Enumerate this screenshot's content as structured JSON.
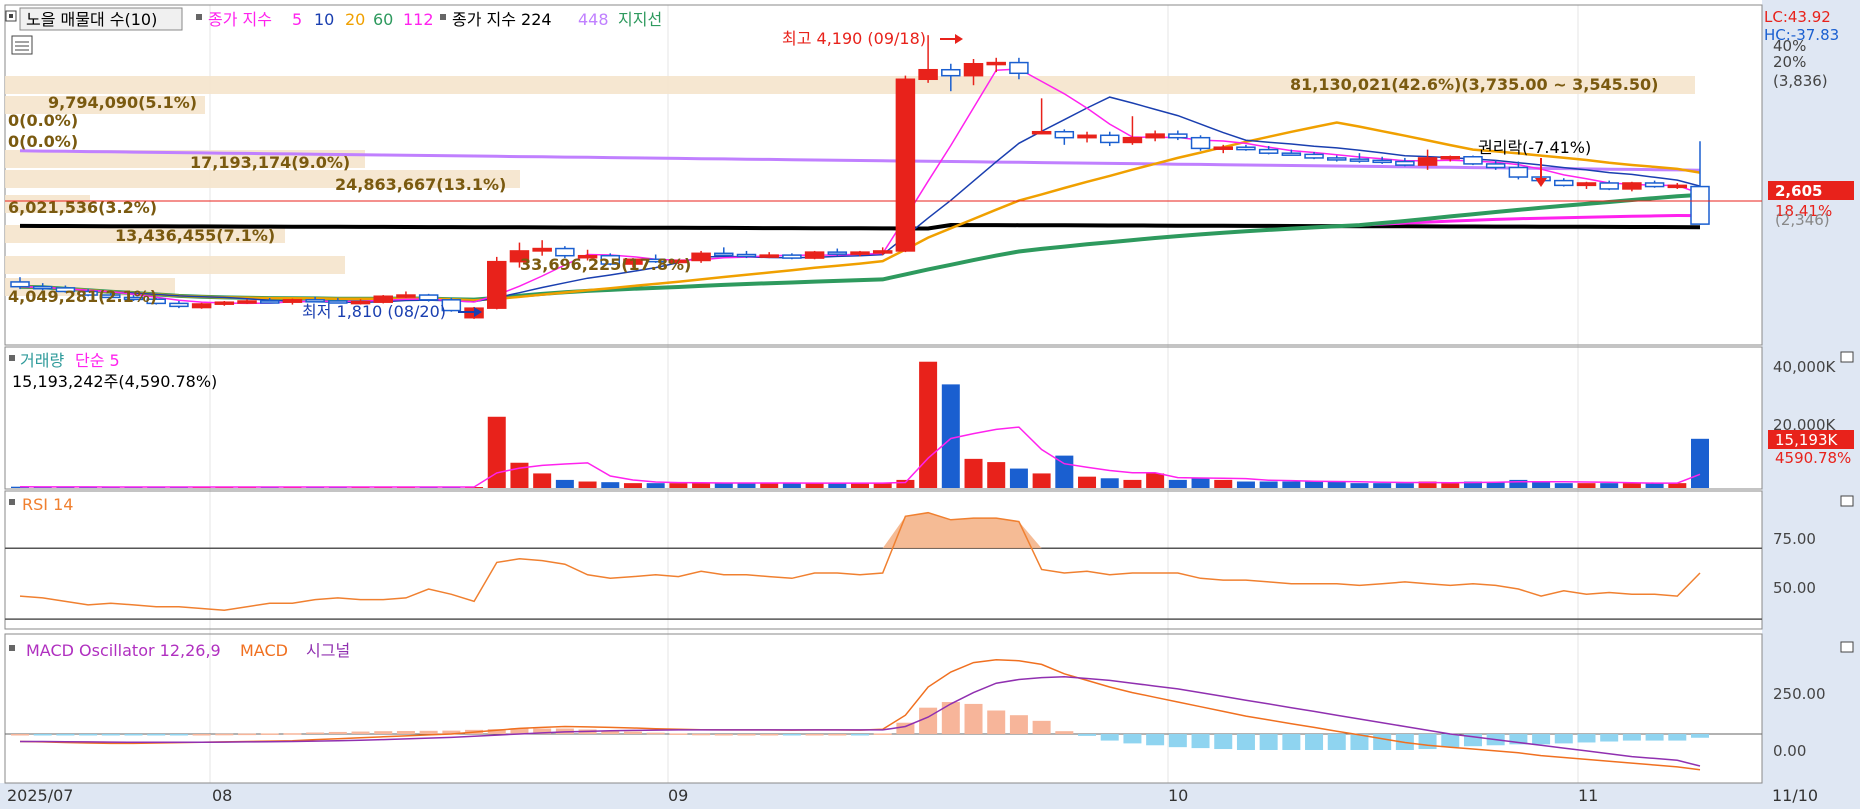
{
  "price_panel": {
    "legend": {
      "volume_profile": "노을 매물대 수(10)",
      "ma_label": "종가 지수",
      "ma_periods": [
        "5",
        "10",
        "20",
        "60",
        "112"
      ],
      "ma2_label": "종가 지수 224",
      "ma2_period": "448",
      "support": "지지선"
    },
    "right_scale": {
      "lc": "LC:43.92",
      "hc": "HC:-37.83",
      "ticks": [
        "40%",
        "20%",
        "(3,836)",
        "18.41%",
        "(2,346)"
      ],
      "current_price": "2,605"
    },
    "annotations": {
      "high": "최고 4,190 (09/18)",
      "low": "최저 1,810 (08/20)",
      "ex_rights": "권리락(-7.41%)"
    },
    "volume_profile_labels": [
      "81,130,021(42.6%)(3,735.00 ~ 3,545.50)",
      "9,794,090(5.1%)",
      "0(0.0%)",
      "0(0.0%)",
      "17,193,174(9.0%)",
      "24,863,667(13.1%)",
      "6,021,536(3.2%)",
      "13,436,455(7.1%)",
      "33,696,225(17.8%)",
      "4,049,281(2.1%)"
    ]
  },
  "volume_panel": {
    "legend_volume": "거래량",
    "legend_ma": "단순 5",
    "info": "15,193,242주(4,590.78%)",
    "ticks": [
      "40,000K",
      "20,000K"
    ],
    "current": "15,193K",
    "current_pct": "4590.78%"
  },
  "rsi_panel": {
    "legend": "RSI 14",
    "ticks": [
      "75.00",
      "50.00"
    ]
  },
  "macd_panel": {
    "legend_osc": "MACD Oscillator 12,26,9",
    "legend_macd": "MACD",
    "legend_signal": "시그널",
    "ticks": [
      "250.00",
      "0.00"
    ]
  },
  "x_axis": {
    "labels": [
      "2025/07",
      "08",
      "09",
      "10",
      "11"
    ],
    "right_label": "11/10"
  },
  "colors": {
    "up": "#e8221b",
    "down": "#1a5fd0",
    "ma5": "#2255d0",
    "ma10": "#1a3fb0",
    "ma20": "#f0a000",
    "ma60": "#2e9a5e",
    "ma112": "#ff22ee",
    "ma224": "#000000",
    "ma448": "#c080ff",
    "profile": "#f5e4cc",
    "rsi": "#f08030",
    "macd": "#f07020",
    "signal": "#9030b0",
    "osc_pos": "#f7b59a",
    "osc_neg": "#8fd4f0"
  },
  "chart_data": [
    {
      "type": "candlestick",
      "title": "",
      "candles": [
        [
          2120,
          2160,
          2060,
          2080
        ],
        [
          2080,
          2110,
          2050,
          2070
        ],
        [
          2070,
          2090,
          2030,
          2040
        ],
        [
          2040,
          2060,
          2000,
          2010
        ],
        [
          2010,
          2030,
          1980,
          1990
        ],
        [
          1990,
          2010,
          1960,
          1975
        ],
        [
          1975,
          1985,
          1930,
          1940
        ],
        [
          1940,
          1960,
          1900,
          1915
        ],
        [
          1905,
          1945,
          1895,
          1935
        ],
        [
          1935,
          1960,
          1920,
          1950
        ],
        [
          1950,
          1975,
          1935,
          1960
        ],
        [
          1960,
          1985,
          1945,
          1950
        ],
        [
          1950,
          1980,
          1930,
          1970
        ],
        [
          1970,
          1995,
          1950,
          1960
        ],
        [
          1960,
          1985,
          1940,
          1950
        ],
        [
          1950,
          1975,
          1930,
          1955
        ],
        [
          1950,
          2010,
          1940,
          2000
        ],
        [
          2000,
          2040,
          1985,
          2010
        ],
        [
          2010,
          2020,
          1955,
          1970
        ],
        [
          1970,
          1985,
          1870,
          1880
        ],
        [
          1820,
          1910,
          1810,
          1900
        ],
        [
          1900,
          2330,
          1890,
          2290
        ],
        [
          2290,
          2450,
          2240,
          2380
        ],
        [
          2380,
          2470,
          2340,
          2400
        ],
        [
          2400,
          2420,
          2320,
          2340
        ],
        [
          2340,
          2390,
          2300,
          2340
        ],
        [
          2340,
          2360,
          2260,
          2270
        ],
        [
          2270,
          2320,
          2240,
          2310
        ],
        [
          2310,
          2350,
          2280,
          2290
        ],
        [
          2290,
          2310,
          2270,
          2300
        ],
        [
          2300,
          2380,
          2280,
          2360
        ],
        [
          2360,
          2410,
          2340,
          2350
        ],
        [
          2350,
          2380,
          2320,
          2340
        ],
        [
          2340,
          2370,
          2320,
          2345
        ],
        [
          2345,
          2360,
          2310,
          2320
        ],
        [
          2320,
          2380,
          2310,
          2370
        ],
        [
          2370,
          2400,
          2340,
          2355
        ],
        [
          2355,
          2380,
          2335,
          2370
        ],
        [
          2370,
          2410,
          2345,
          2380
        ],
        [
          2380,
          3850,
          2370,
          3820
        ],
        [
          3820,
          4190,
          3790,
          3900
        ],
        [
          3900,
          3950,
          3720,
          3850
        ],
        [
          3850,
          3990,
          3770,
          3950
        ],
        [
          3950,
          4000,
          3880,
          3960
        ],
        [
          3960,
          4000,
          3820,
          3870
        ],
        [
          3380,
          3660,
          3360,
          3380
        ],
        [
          3380,
          3400,
          3270,
          3330
        ],
        [
          3330,
          3380,
          3290,
          3350
        ],
        [
          3350,
          3380,
          3260,
          3290
        ],
        [
          3290,
          3510,
          3270,
          3330
        ],
        [
          3330,
          3390,
          3300,
          3360
        ],
        [
          3360,
          3390,
          3310,
          3330
        ],
        [
          3330,
          3350,
          3220,
          3240
        ],
        [
          3240,
          3270,
          3200,
          3250
        ],
        [
          3250,
          3270,
          3220,
          3230
        ],
        [
          3230,
          3260,
          3190,
          3200
        ],
        [
          3200,
          3230,
          3180,
          3190
        ],
        [
          3190,
          3210,
          3150,
          3160
        ],
        [
          3160,
          3180,
          3130,
          3150
        ],
        [
          3150,
          3200,
          3120,
          3140
        ],
        [
          3140,
          3170,
          3110,
          3130
        ],
        [
          3130,
          3160,
          3090,
          3100
        ],
        [
          3100,
          3230,
          3060,
          3160
        ],
        [
          3160,
          3180,
          3130,
          3170
        ],
        [
          3170,
          3180,
          3100,
          3110
        ],
        [
          3110,
          3140,
          3060,
          3080
        ],
        [
          3080,
          3130,
          2980,
          3000
        ],
        [
          3000,
          3020,
          2960,
          2970
        ],
        [
          2970,
          2990,
          2920,
          2930
        ],
        [
          2930,
          2960,
          2900,
          2950
        ],
        [
          2950,
          2970,
          2890,
          2900
        ],
        [
          2900,
          2960,
          2880,
          2950
        ],
        [
          2950,
          2970,
          2910,
          2920
        ],
        [
          2920,
          2950,
          2900,
          2930
        ],
        [
          2920,
          3300,
          2600,
          2605
        ]
      ]
    },
    {
      "type": "bar",
      "title": "거래량",
      "unit": "K",
      "values": [
        400,
        300,
        300,
        300,
        300,
        300,
        300,
        300,
        300,
        300,
        300,
        300,
        300,
        300,
        300,
        300,
        300,
        400,
        300,
        300,
        300,
        22000,
        7800,
        4500,
        2500,
        2000,
        1800,
        1500,
        1500,
        1500,
        1700,
        1500,
        1500,
        1500,
        1500,
        1500,
        1500,
        1500,
        1500,
        2500,
        39000,
        32000,
        9000,
        8000,
        6000,
        4500,
        10000,
        3500,
        3000,
        2500,
        4500,
        2500,
        3000,
        2500,
        2000,
        2000,
        2000,
        2000,
        2000,
        1500,
        1500,
        1500,
        2000,
        1500,
        2000,
        1800,
        2500,
        2000,
        1500,
        1500,
        1500,
        1500,
        1500,
        1500,
        15193
      ],
      "ylim": [
        0,
        42000
      ]
    },
    {
      "type": "line",
      "title": "RSI 14",
      "values": [
        43,
        42,
        40,
        38,
        39,
        38,
        37,
        37,
        36,
        35,
        37,
        39,
        39,
        41,
        42,
        41,
        41,
        42,
        47,
        44,
        40,
        62,
        64,
        63,
        61,
        55,
        53,
        54,
        55,
        54,
        57,
        55,
        55,
        54,
        53,
        56,
        56,
        55,
        56,
        88,
        90,
        86,
        87,
        87,
        85,
        58,
        56,
        57,
        55,
        56,
        56,
        56,
        53,
        52,
        52,
        51,
        50,
        50,
        50,
        49,
        50,
        51,
        50,
        49,
        50,
        49,
        47,
        43,
        46,
        44,
        45,
        44,
        44,
        43,
        56
      ],
      "ylim": [
        25,
        100
      ]
    },
    {
      "type": "line",
      "title": "MACD Oscillator 12,26,9",
      "macd": [
        -40,
        -42,
        -45,
        -48,
        -50,
        -50,
        -48,
        -46,
        -44,
        -42,
        -40,
        -38,
        -36,
        -30,
        -25,
        -20,
        -15,
        -10,
        -5,
        0,
        10,
        20,
        30,
        35,
        40,
        38,
        35,
        32,
        28,
        25,
        23,
        22,
        22,
        22,
        21,
        22,
        22,
        21,
        25,
        100,
        250,
        330,
        380,
        395,
        390,
        370,
        320,
        285,
        250,
        220,
        195,
        170,
        145,
        120,
        95,
        75,
        55,
        35,
        15,
        -5,
        -25,
        -45,
        -60,
        -70,
        -80,
        -90,
        -100,
        -115,
        -125,
        -135,
        -145,
        -155,
        -165,
        -175,
        -190
      ],
      "signal": [
        -40,
        -40,
        -41,
        -42,
        -43,
        -44,
        -44,
        -44,
        -44,
        -43,
        -42,
        -41,
        -40,
        -38,
        -36,
        -33,
        -30,
        -26,
        -22,
        -18,
        -12,
        -6,
        0,
        6,
        11,
        14,
        17,
        19,
        21,
        22,
        22,
        22,
        22,
        22,
        22,
        22,
        22,
        22,
        22,
        40,
        90,
        160,
        220,
        270,
        290,
        300,
        305,
        295,
        285,
        270,
        255,
        240,
        220,
        200,
        180,
        160,
        140,
        120,
        100,
        80,
        60,
        40,
        20,
        0,
        -15,
        -30,
        -45,
        -60,
        -75,
        -90,
        -105,
        -120,
        -130,
        -140,
        -170
      ],
      "oscillator": [
        0,
        -2,
        -4,
        -6,
        -7,
        -6,
        -4,
        -2,
        0,
        1,
        2,
        3,
        4,
        8,
        11,
        13,
        15,
        16,
        17,
        18,
        22,
        26,
        30,
        29,
        29,
        24,
        18,
        13,
        7,
        3,
        1,
        0,
        0,
        0,
        -1,
        0,
        0,
        -1,
        3,
        60,
        140,
        170,
        160,
        125,
        100,
        70,
        15,
        -10,
        -35,
        -50,
        -60,
        -70,
        -75,
        -80,
        -85,
        -85,
        -85,
        -85,
        -85,
        -85,
        -85,
        -85,
        -80,
        -70,
        -65,
        -60,
        -55,
        -55,
        -50,
        -45,
        -40,
        -35,
        -35,
        -35,
        -20
      ],
      "ylim": [
        -250,
        500
      ]
    }
  ]
}
